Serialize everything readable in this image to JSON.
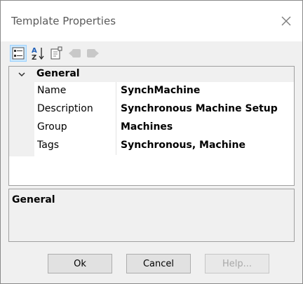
{
  "window": {
    "title": "Template Properties"
  },
  "toolbar": {
    "buttons": [
      {
        "icon": "categorized-icon",
        "active": true
      },
      {
        "icon": "sort-alphabetical-icon"
      },
      {
        "icon": "property-pages-icon"
      },
      {
        "icon": "back-icon"
      },
      {
        "icon": "forward-icon"
      }
    ]
  },
  "grid": {
    "category": "General",
    "rows": [
      {
        "name": "Name",
        "value": "SynchMachine"
      },
      {
        "name": "Description",
        "value": "Synchronous Machine Setup"
      },
      {
        "name": "Group",
        "value": "Machines"
      },
      {
        "name": "Tags",
        "value": "Synchronous, Machine"
      }
    ]
  },
  "description": {
    "title": "General"
  },
  "buttons": {
    "ok": "Ok",
    "cancel": "Cancel",
    "help": "Help..."
  },
  "colors": {
    "selected_bg": "#cce8ff",
    "panel_bg": "#f0f0f0"
  }
}
